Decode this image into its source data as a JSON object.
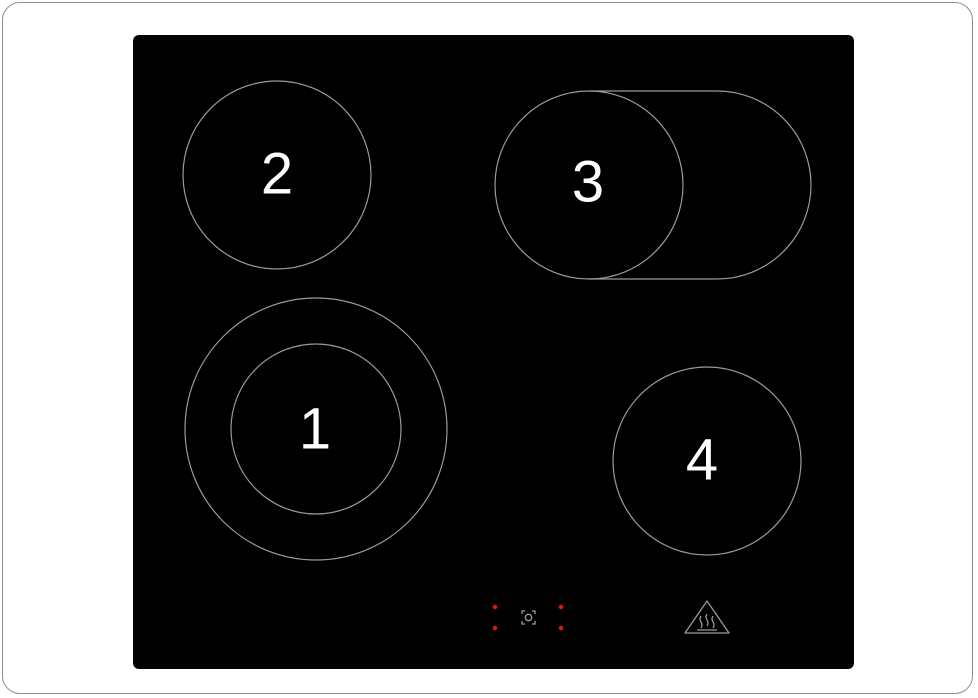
{
  "cooktop": {
    "zones": [
      {
        "label": "1",
        "type": "dual-ring"
      },
      {
        "label": "2",
        "type": "single"
      },
      {
        "label": "3",
        "type": "extended-oval"
      },
      {
        "label": "4",
        "type": "single"
      }
    ],
    "indicator_color": "#e3171b",
    "glass_color": "#000000",
    "outline_color": "#9a9a9a",
    "frame_color": "#8e8e8e",
    "icons": [
      "control-symbol-icon",
      "hot-surface-warning-icon"
    ]
  }
}
